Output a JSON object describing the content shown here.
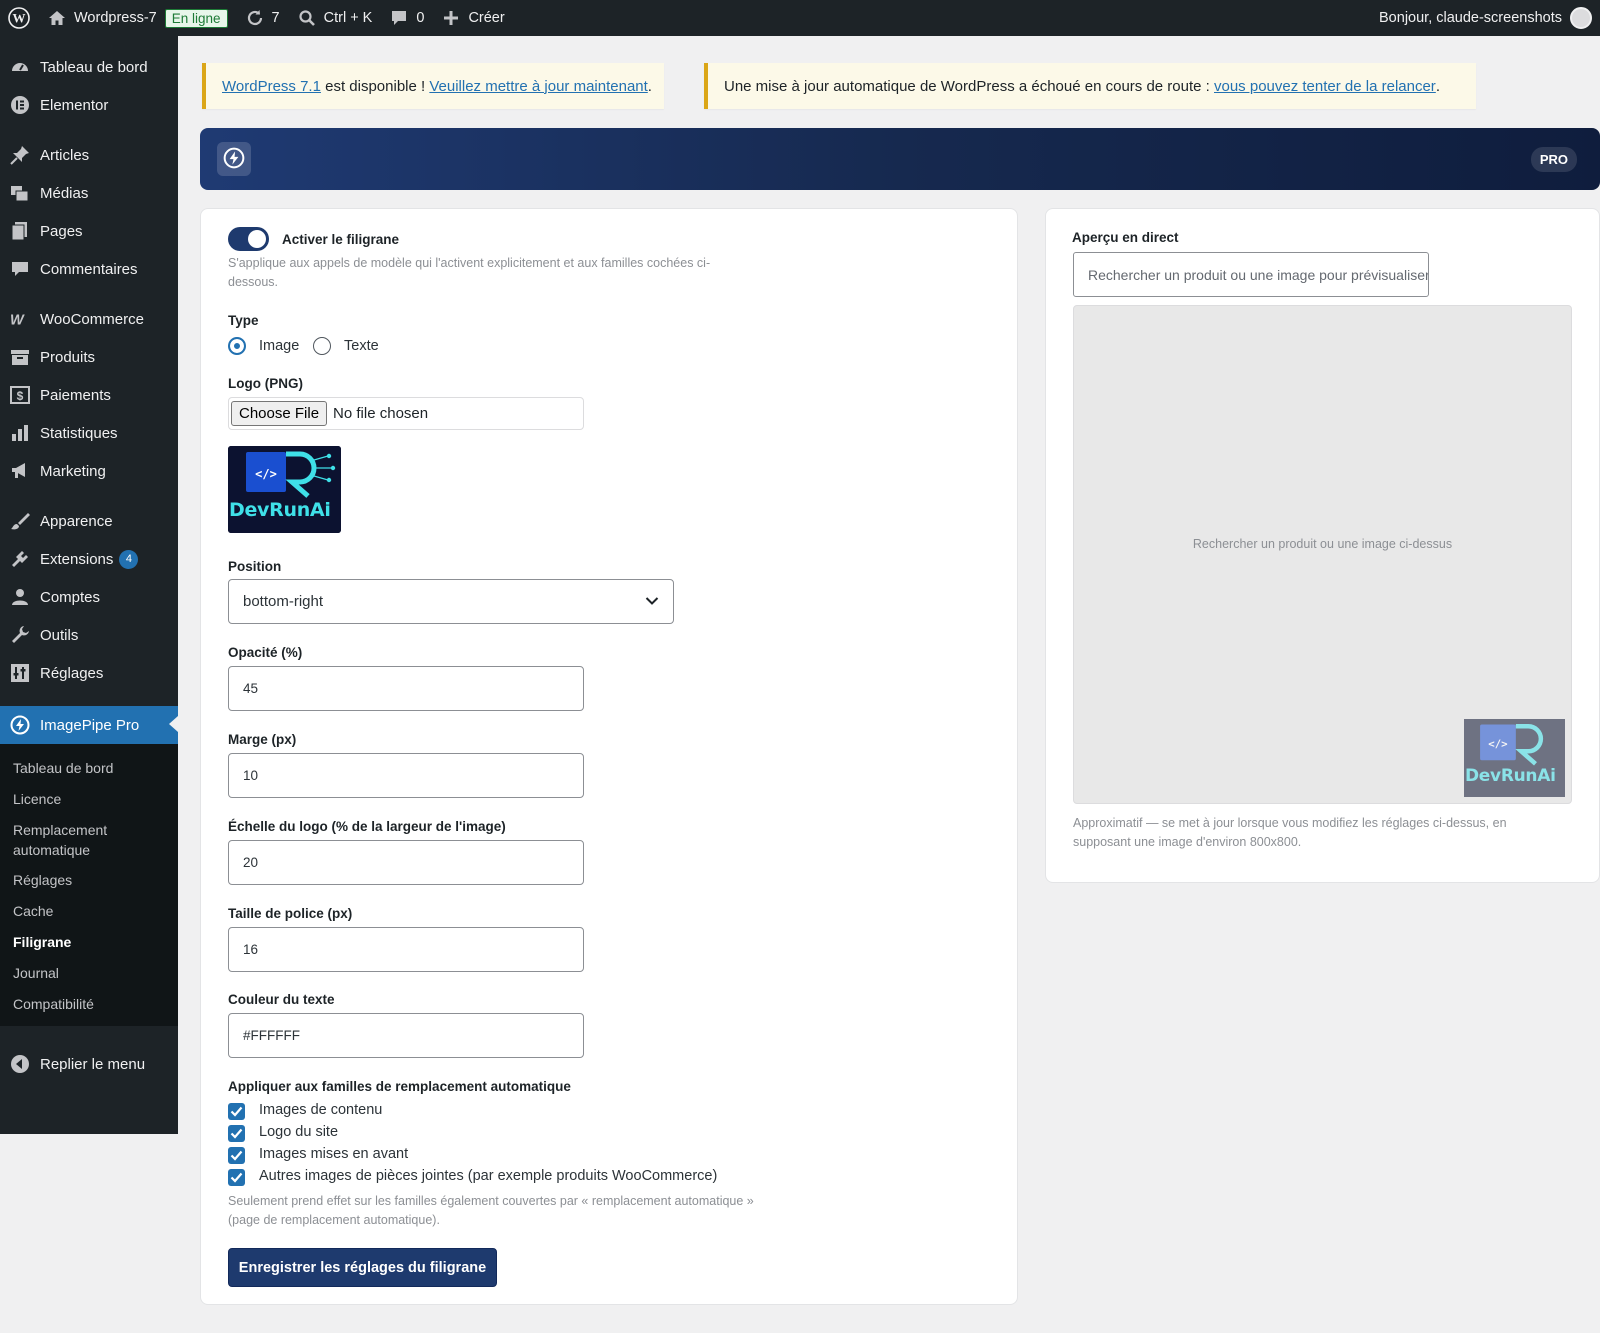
{
  "adminbar": {
    "site_name": "Wordpress-7",
    "status_badge": "En ligne",
    "updates_count": "7",
    "search_shortcut": "Ctrl + K",
    "comments_count": "0",
    "new_label": "Créer",
    "greeting": "Bonjour, claude-screenshots"
  },
  "sidebar": {
    "items": [
      {
        "label": "Tableau de bord",
        "icon": "dashboard-icon"
      },
      {
        "label": "Elementor",
        "icon": "elementor-icon"
      },
      {
        "label": "Articles",
        "icon": "pin-icon"
      },
      {
        "label": "Médias",
        "icon": "media-icon"
      },
      {
        "label": "Pages",
        "icon": "pages-icon"
      },
      {
        "label": "Commentaires",
        "icon": "comments-icon"
      },
      {
        "label": "WooCommerce",
        "icon": "woocommerce-icon"
      },
      {
        "label": "Produits",
        "icon": "products-icon"
      },
      {
        "label": "Paiements",
        "icon": "payments-icon"
      },
      {
        "label": "Statistiques",
        "icon": "stats-icon"
      },
      {
        "label": "Marketing",
        "icon": "megaphone-icon"
      },
      {
        "label": "Apparence",
        "icon": "brush-icon"
      },
      {
        "label": "Extensions",
        "icon": "plugins-icon",
        "badge": "4"
      },
      {
        "label": "Comptes",
        "icon": "users-icon"
      },
      {
        "label": "Outils",
        "icon": "wrench-icon"
      },
      {
        "label": "Réglages",
        "icon": "settings-icon"
      },
      {
        "label": "ImagePipe Pro",
        "icon": "bolt-icon"
      }
    ],
    "submenu": [
      "Tableau de bord",
      "Licence",
      "Remplacement automatique",
      "Réglages",
      "Cache",
      "Filigrane",
      "Journal",
      "Compatibilité"
    ],
    "collapse_label": "Replier le menu"
  },
  "notices": {
    "update_link": "WordPress 7.1",
    "update_text": " est disponible ! ",
    "update_action": "Veuillez mettre à jour maintenant",
    "update_end": ".",
    "fail_text": "Une mise à jour automatique de WordPress a échoué en cours de route : ",
    "fail_link": "vous pouvez tenter de la relancer",
    "fail_end": "."
  },
  "banner": {
    "pro_badge": "PRO"
  },
  "settings": {
    "enable_label": "Activer le filigrane",
    "enable_help": "S'applique aux appels de modèle qui l'activent explicitement et aux familles cochées ci-dessous.",
    "enabled": true,
    "type_label": "Type",
    "type_options": [
      "Image",
      "Texte"
    ],
    "type_selected": "Image",
    "logo_label": "Logo (PNG)",
    "file_button": "Choose File",
    "file_status": "No file chosen",
    "logo_text": "DevRunAi",
    "position_label": "Position",
    "position_value": "bottom-right",
    "opacity_label": "Opacité (%)",
    "opacity_value": "45",
    "margin_label": "Marge (px)",
    "margin_value": "10",
    "scale_label": "Échelle du logo (% de la largeur de l'image)",
    "scale_value": "20",
    "fontsize_label": "Taille de police (px)",
    "fontsize_value": "16",
    "color_label": "Couleur du texte",
    "color_value": "#FFFFFF",
    "families_label": "Appliquer aux familles de remplacement automatique",
    "families": [
      {
        "label": "Images de contenu",
        "checked": true
      },
      {
        "label": "Logo du site",
        "checked": true
      },
      {
        "label": "Images mises en avant",
        "checked": true
      },
      {
        "label": "Autres images de pièces jointes (par exemple produits WooCommerce)",
        "checked": true
      }
    ],
    "families_help": "Seulement prend effet sur les familles également couvertes par « remplacement automatique » (page de remplacement automatique).",
    "save_label": "Enregistrer les réglages du filigrane"
  },
  "preview": {
    "title": "Aperçu en direct",
    "search_placeholder": "Rechercher un produit ou une image pour prévisualiser",
    "empty_text": "Rechercher un produit ou une image ci-dessus",
    "help": "Approximatif — se met à jour lorsque vous modifiez les réglages ci-dessus, en supposant une image d'environ 800x800."
  },
  "colors": {
    "accent": "#2271b1",
    "brand_dark": "#1e3a6e",
    "sidebar_bg": "#1d2327",
    "notice_border": "#dba617"
  }
}
